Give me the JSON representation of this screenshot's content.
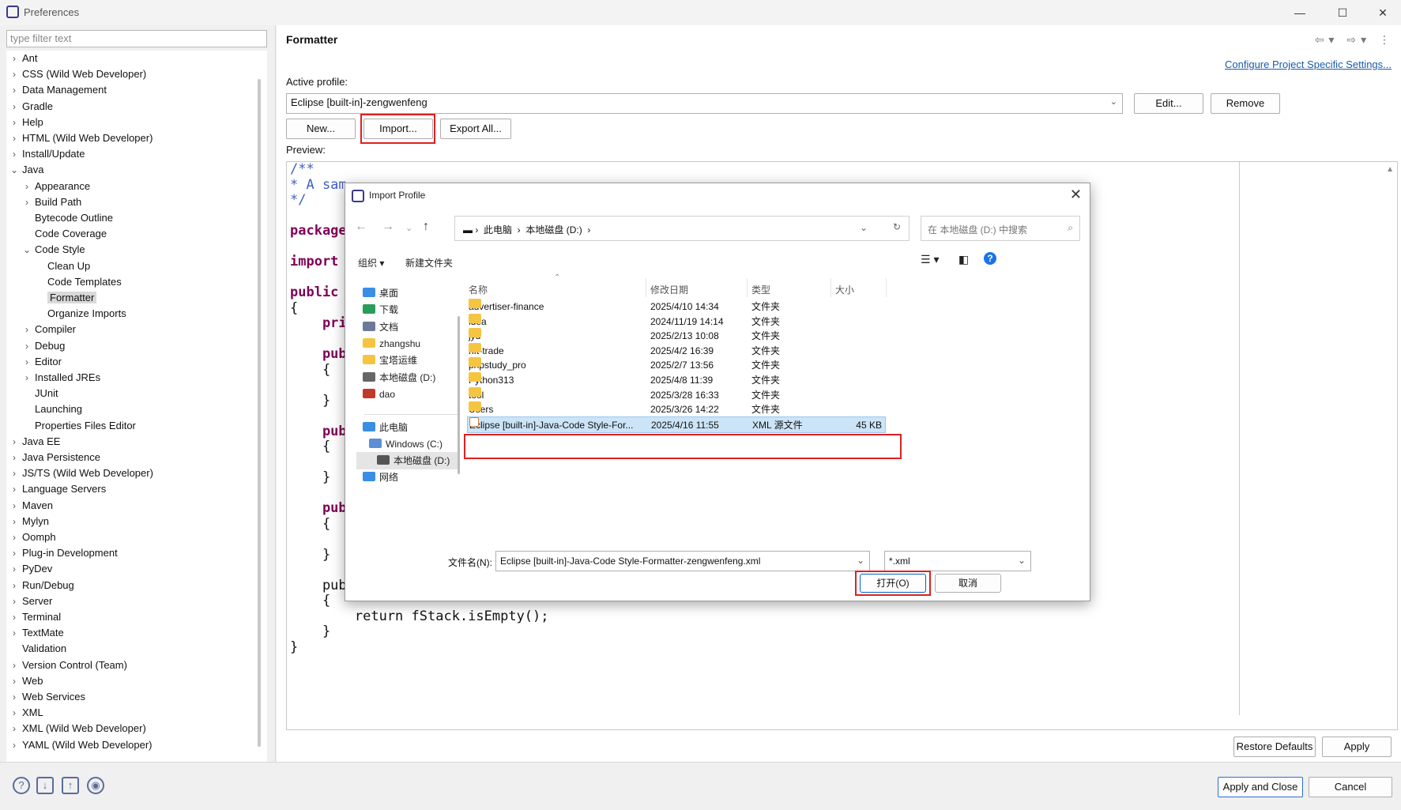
{
  "window": {
    "title": "Preferences"
  },
  "filter": {
    "placeholder": "type filter text"
  },
  "tree": {
    "items": [
      {
        "label": "Ant",
        "expander": "›"
      },
      {
        "label": "CSS (Wild Web Developer)",
        "expander": "›"
      },
      {
        "label": "Data Management",
        "expander": "›"
      },
      {
        "label": "Gradle",
        "expander": "›"
      },
      {
        "label": "Help",
        "expander": "›"
      },
      {
        "label": "HTML (Wild Web Developer)",
        "expander": "›"
      },
      {
        "label": "Install/Update",
        "expander": "›"
      },
      {
        "label": "Java",
        "expander": "⌄"
      },
      {
        "label": "Appearance",
        "expander": "›"
      },
      {
        "label": "Build Path",
        "expander": "›"
      },
      {
        "label": "Bytecode Outline",
        "expander": ""
      },
      {
        "label": "Code Coverage",
        "expander": ""
      },
      {
        "label": "Code Style",
        "expander": "⌄"
      },
      {
        "label": "Clean Up",
        "expander": ""
      },
      {
        "label": "Code Templates",
        "expander": ""
      },
      {
        "label": "Formatter",
        "expander": ""
      },
      {
        "label": "Organize Imports",
        "expander": ""
      },
      {
        "label": "Compiler",
        "expander": "›"
      },
      {
        "label": "Debug",
        "expander": "›"
      },
      {
        "label": "Editor",
        "expander": "›"
      },
      {
        "label": "Installed JREs",
        "expander": "›"
      },
      {
        "label": "JUnit",
        "expander": ""
      },
      {
        "label": "Launching",
        "expander": ""
      },
      {
        "label": "Properties Files Editor",
        "expander": ""
      },
      {
        "label": "Java EE",
        "expander": "›"
      },
      {
        "label": "Java Persistence",
        "expander": "›"
      },
      {
        "label": "JS/TS (Wild Web Developer)",
        "expander": "›"
      },
      {
        "label": "Language Servers",
        "expander": "›"
      },
      {
        "label": "Maven",
        "expander": "›"
      },
      {
        "label": "Mylyn",
        "expander": "›"
      },
      {
        "label": "Oomph",
        "expander": "›"
      },
      {
        "label": "Plug-in Development",
        "expander": "›"
      },
      {
        "label": "PyDev",
        "expander": "›"
      },
      {
        "label": "Run/Debug",
        "expander": "›"
      },
      {
        "label": "Server",
        "expander": "›"
      },
      {
        "label": "Terminal",
        "expander": "›"
      },
      {
        "label": "TextMate",
        "expander": "›"
      },
      {
        "label": "Validation",
        "expander": ""
      },
      {
        "label": "Version Control (Team)",
        "expander": "›"
      },
      {
        "label": "Web",
        "expander": "›"
      },
      {
        "label": "Web Services",
        "expander": "›"
      },
      {
        "label": "XML",
        "expander": "›"
      },
      {
        "label": "XML (Wild Web Developer)",
        "expander": "›"
      },
      {
        "label": "YAML (Wild Web Developer)",
        "expander": "›"
      }
    ]
  },
  "panel": {
    "title": "Formatter",
    "configure_link": "Configure Project Specific Settings...",
    "active_profile_label": "Active profile:",
    "active_profile_value": "Eclipse [built-in]-zengwenfeng",
    "edit": "Edit...",
    "remove": "Remove",
    "new": "New...",
    "import": "Import...",
    "export_all": "Export All...",
    "preview_label": "Preview:",
    "restore_defaults": "Restore Defaults",
    "apply": "Apply"
  },
  "code": {
    "lines": [
      "/**",
      "* A sam",
      "*/",
      "",
      "package",
      "",
      "import",
      "",
      "public",
      "{",
      "    pri",
      "",
      "    pub",
      "    {",
      "",
      "    }",
      "",
      "    pub",
      "    {",
      "",
      "    }",
      "",
      "    pub",
      "    {",
      "",
      "    }",
      "",
      "    public boolean isEmpty()",
      "    {",
      "        return fStack.isEmpty();",
      "    }",
      "}"
    ]
  },
  "footer": {
    "apply_close": "Apply and Close",
    "cancel": "Cancel"
  },
  "dialog": {
    "title": "Import Profile",
    "address": [
      "此电脑",
      "本地磁盘 (D:)"
    ],
    "search_placeholder": "在 本地磁盘 (D:) 中搜索",
    "organize": "组织 ▾",
    "new_folder": "新建文件夹",
    "sidebar": {
      "quick": [
        {
          "label": "桌面",
          "color": "#3a8ee6"
        },
        {
          "label": "下载",
          "color": "#2a9d5c"
        },
        {
          "label": "文档",
          "color": "#6b7a99"
        },
        {
          "label": "zhangshu",
          "color": "#f5c542"
        },
        {
          "label": "宝塔运维",
          "color": "#f5c542"
        },
        {
          "label": "本地磁盘 (D:)",
          "color": "#666666"
        },
        {
          "label": "dao",
          "color": "#c0392b"
        }
      ],
      "pc": "此电脑",
      "drives": [
        "Windows (C:)",
        "本地磁盘 (D:)"
      ],
      "network": "网络"
    },
    "columns": {
      "name": "名称",
      "date": "修改日期",
      "type": "类型",
      "size": "大小"
    },
    "files": [
      {
        "name": "advertiser-finance",
        "date": "2025/4/10 14:34",
        "type": "文件夹",
        "size": ""
      },
      {
        "name": "idea",
        "date": "2024/11/19 14:14",
        "type": "文件夹",
        "size": ""
      },
      {
        "name": "jyd",
        "date": "2025/2/13 10:08",
        "type": "文件夹",
        "size": ""
      },
      {
        "name": "nft-trade",
        "date": "2025/4/2 16:39",
        "type": "文件夹",
        "size": ""
      },
      {
        "name": "phpstudy_pro",
        "date": "2025/2/7 13:56",
        "type": "文件夹",
        "size": ""
      },
      {
        "name": "Python313",
        "date": "2025/4/8 11:39",
        "type": "文件夹",
        "size": ""
      },
      {
        "name": "tool",
        "date": "2025/3/28 16:33",
        "type": "文件夹",
        "size": ""
      },
      {
        "name": "Users",
        "date": "2025/3/26 14:22",
        "type": "文件夹",
        "size": ""
      }
    ],
    "selected_file": {
      "name": "Eclipse [built-in]-Java-Code Style-For...",
      "date": "2025/4/16 11:55",
      "type": "XML 源文件",
      "size": "45 KB"
    },
    "filename_label": "文件名(N):",
    "filename_value": "Eclipse [built-in]-Java-Code Style-Formatter-zengwenfeng.xml",
    "filetype_value": "*.xml",
    "open": "打开(O)",
    "cancel": "取消"
  }
}
